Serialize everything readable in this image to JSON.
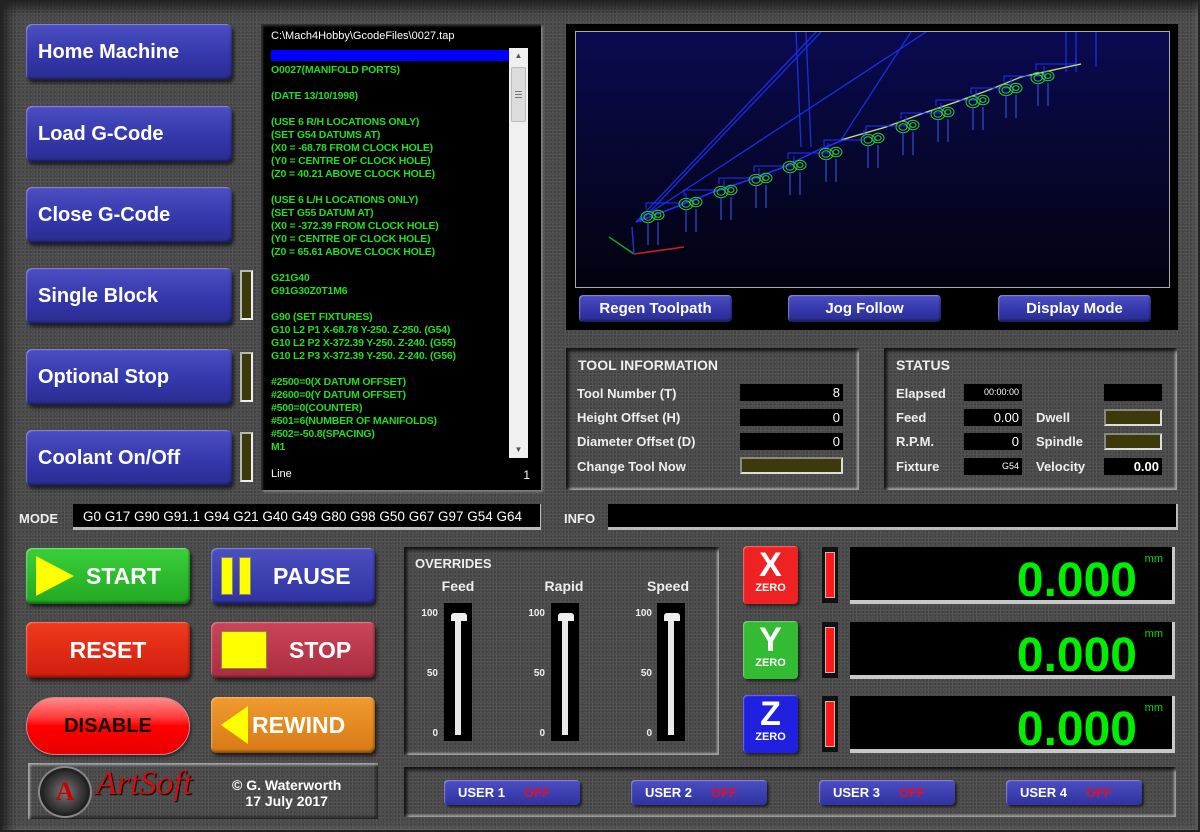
{
  "side_buttons": [
    {
      "label": "Home Machine",
      "has_led": false
    },
    {
      "label": "Load G-Code",
      "has_led": false
    },
    {
      "label": "Close G-Code",
      "has_led": false
    },
    {
      "label": "Single Block",
      "has_led": true
    },
    {
      "label": "Optional Stop",
      "has_led": true
    },
    {
      "label": "Coolant On/Off",
      "has_led": true
    }
  ],
  "gcode": {
    "file_path": "C:\\Mach4Hobby\\GcodeFiles\\0027.tap",
    "lines": [
      "O0027(MANIFOLD PORTS)",
      "",
      "(DATE 13/10/1998)",
      "",
      "(USE 6 R/H LOCATIONS ONLY)",
      "(SET G54 DATUMS AT)",
      "(X0 = -68.78 FROM CLOCK HOLE)",
      "(Y0 = CENTRE OF CLOCK HOLE)",
      "(Z0 = 40.21 ABOVE CLOCK HOLE)",
      "",
      "(USE 6 L/H LOCATIONS ONLY)",
      "(SET G55 DATUM AT)",
      "(X0 = -372.39 FROM CLOCK HOLE)",
      "(Y0 = CENTRE OF CLOCK HOLE)",
      "(Z0 = 65.61 ABOVE CLOCK HOLE)",
      "",
      "G21G40",
      "G91G30Z0T1M6",
      "",
      "G90 (SET FIXTURES)",
      "G10 L2 P1 X-68.78 Y-250. Z-250. (G54)",
      "G10 L2 P2 X-372.39 Y-250. Z-240. (G55)",
      "G10 L2 P3 X-372.39 Y-250. Z-240. (G56)",
      "",
      "#2500=0(X DATUM OFFSET)",
      "#2600=0(Y DATUM OFFSET)",
      "#500=0(COUNTER)",
      "#501=6(NUMBER OF MANIFOLDS)",
      "#502=-50.8(SPACING)",
      "M1"
    ],
    "line_label": "Line",
    "line_value": "1",
    "scroll_up_icon": "▲",
    "scroll_down_icon": "▼"
  },
  "toolpath": {
    "buttons": {
      "regen": "Regen Toolpath",
      "jog_follow": "Jog Follow",
      "display_mode": "Display Mode"
    }
  },
  "tool_info": {
    "title": "TOOL INFORMATION",
    "tool_number_label": "Tool Number (T)",
    "tool_number": "8",
    "height_offset_label": "Height Offset (H)",
    "height_offset": "0",
    "diameter_offset_label": "Diameter Offset (D)",
    "diameter_offset": "0",
    "change_tool_label": "Change Tool Now"
  },
  "status": {
    "title": "STATUS",
    "elapsed_label": "Elapsed",
    "elapsed": "00:00:00",
    "feed_label": "Feed",
    "feed": "0.00",
    "rpm_label": "R.P.M.",
    "rpm": "0",
    "fixture_label": "Fixture",
    "fixture": "G54",
    "dwell_label": "Dwell",
    "spindle_label": "Spindle",
    "velocity_label": "Velocity",
    "velocity": "0.00"
  },
  "mode": {
    "label": "MODE",
    "value": "G0 G17 G90 G91.1 G94 G21 G40 G49 G80 G98 G50 G67 G97 G54 G64"
  },
  "info": {
    "label": "INFO",
    "value": ""
  },
  "controls": {
    "start": "START",
    "pause": "PAUSE",
    "reset": "RESET",
    "stop": "STOP",
    "disable": "DISABLE",
    "rewind": "REWIND"
  },
  "logo": {
    "brand": "ArtSoft",
    "mark": "A",
    "copyright_line1": "© G. Waterworth",
    "copyright_line2": "17 July 2017"
  },
  "overrides": {
    "title": "OVERRIDES",
    "sliders": [
      {
        "label": "Feed",
        "value_percent": 100
      },
      {
        "label": "Rapid",
        "value_percent": 100
      },
      {
        "label": "Speed",
        "value_percent": 100
      }
    ],
    "ticks": [
      "100",
      "50",
      "0"
    ]
  },
  "axes": [
    {
      "axis": "X",
      "zero_label": "ZERO",
      "value": "0.000",
      "unit": "mm",
      "color": "#ee2222"
    },
    {
      "axis": "Y",
      "zero_label": "ZERO",
      "value": "0.000",
      "unit": "mm",
      "color": "#33bb33"
    },
    {
      "axis": "Z",
      "zero_label": "ZERO",
      "value": "0.000",
      "unit": "mm",
      "color": "#2020e0"
    }
  ],
  "user_buttons": [
    {
      "label": "USER 1",
      "state": "OFF"
    },
    {
      "label": "USER 2",
      "state": "OFF"
    },
    {
      "label": "USER 3",
      "state": "OFF"
    },
    {
      "label": "USER 4",
      "state": "OFF"
    }
  ]
}
